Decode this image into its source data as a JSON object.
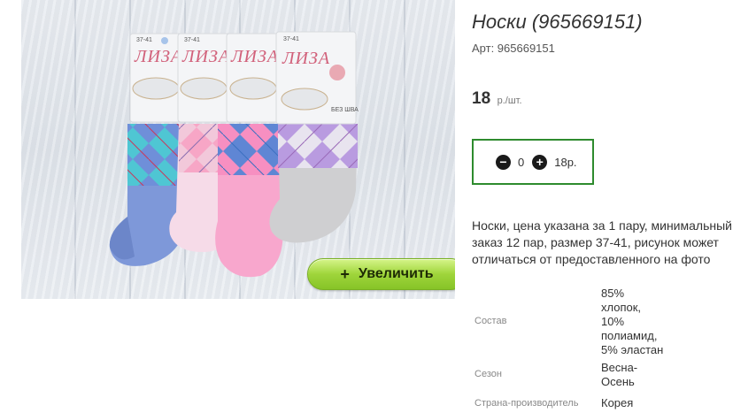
{
  "product": {
    "title": "Носки (965669151)",
    "sku": "Арт: 965669151",
    "price_value": "18",
    "price_unit": "р./шт.",
    "description": "Носки, цена указана за 1 пару, минимальный заказ 12 пар, размер 37-41, рисунок может отличаться от предоставленного на фото"
  },
  "image": {
    "brand_text": "ЛИЗА",
    "size_text": "37-41",
    "no_seam_text": "БЕЗ ШВА",
    "zoom_plus": "+",
    "zoom_label": "Увеличить"
  },
  "quantity": {
    "minus_icon": "−",
    "plus_icon": "+",
    "value": "0",
    "sum": "18р."
  },
  "specs": {
    "composition": {
      "label": "Состав",
      "value_lines": [
        "85%",
        "хлопок,",
        "10%",
        "полиамид,",
        "5% эластан"
      ]
    },
    "season": {
      "label": "Сезон",
      "value_lines": [
        "Весна-",
        "Осень"
      ]
    },
    "country": {
      "label": "Страна-производитель",
      "value": "Корея"
    }
  },
  "colors": {
    "accent_border": "#2e8b2e",
    "zoom_button": "#9fd53b"
  }
}
